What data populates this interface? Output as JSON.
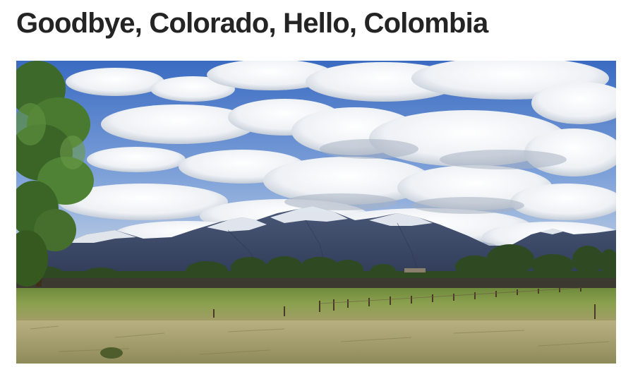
{
  "article": {
    "title": "Goodbye, Colorado, Hello, Colombia"
  },
  "hero_image": {
    "subject": "landscape-photo",
    "colors": {
      "sky_top": "#3f6fc4",
      "sky_bottom": "#9cbbe3",
      "cloud": "#f5f7fa",
      "cloud_shadow": "#b9c2cf",
      "mountain": "#3e4a68",
      "snow": "#eef2f7",
      "trees": "#2f4f22",
      "grass": "#7f9848",
      "dry_grass": "#b7ad7c"
    }
  }
}
